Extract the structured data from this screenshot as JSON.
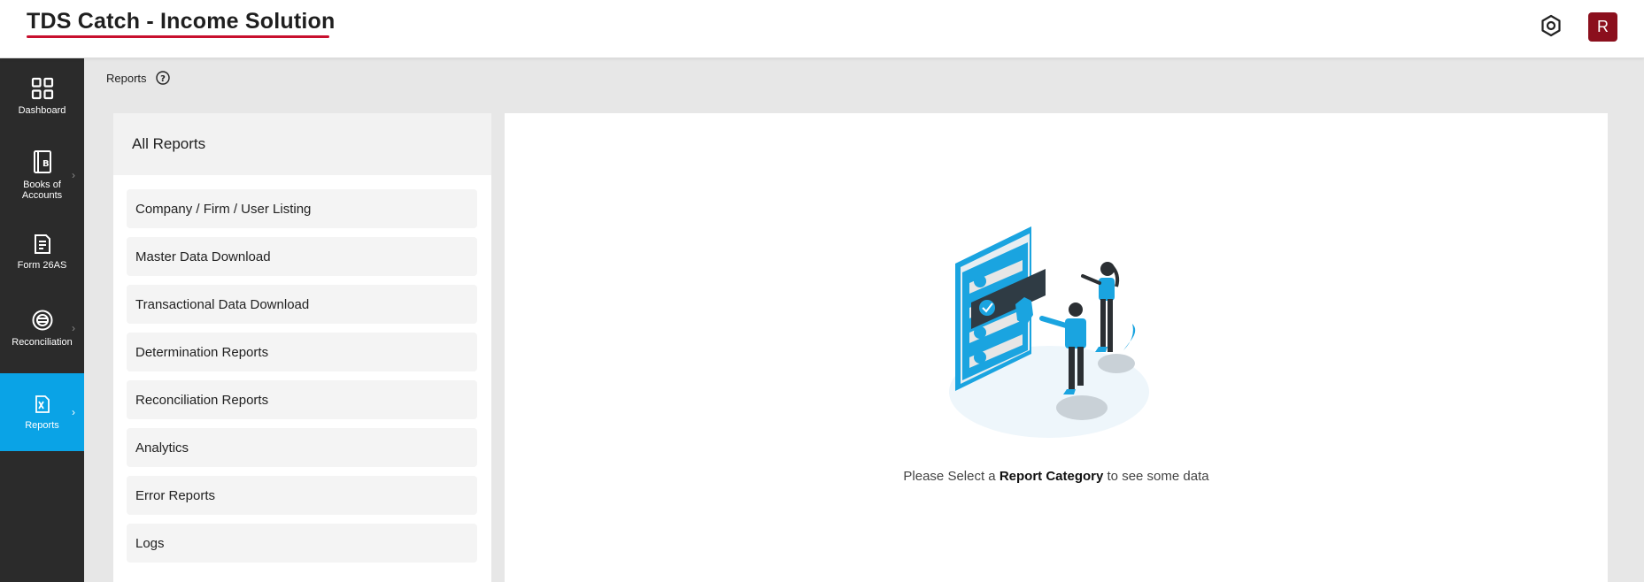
{
  "header": {
    "app_title": "TDS Catch - Income Solution",
    "avatar_initial": "R",
    "accent_color": "#c8102e"
  },
  "sidebar": {
    "items": [
      {
        "label": "Dashboard",
        "icon": "grid-icon"
      },
      {
        "label": "Books of\nAccounts",
        "icon": "book-icon"
      },
      {
        "label": "Form 26AS",
        "icon": "form-icon"
      },
      {
        "label": "Reconciliation",
        "icon": "reconcile-icon"
      },
      {
        "label": "Reports",
        "icon": "excel-icon",
        "active": true
      }
    ],
    "active_color": "#0aa3e6"
  },
  "breadcrumb": {
    "title": "Reports"
  },
  "reports": {
    "header": "All Reports",
    "items": [
      "Company / Firm / User Listing",
      "Master Data Download",
      "Transactional Data Download",
      "Determination Reports",
      "Reconciliation Reports",
      "Analytics",
      "Error Reports",
      "Logs"
    ]
  },
  "content": {
    "msg_prefix": "Please Select a ",
    "msg_bold": "Report Category",
    "msg_suffix": " to see some data"
  }
}
